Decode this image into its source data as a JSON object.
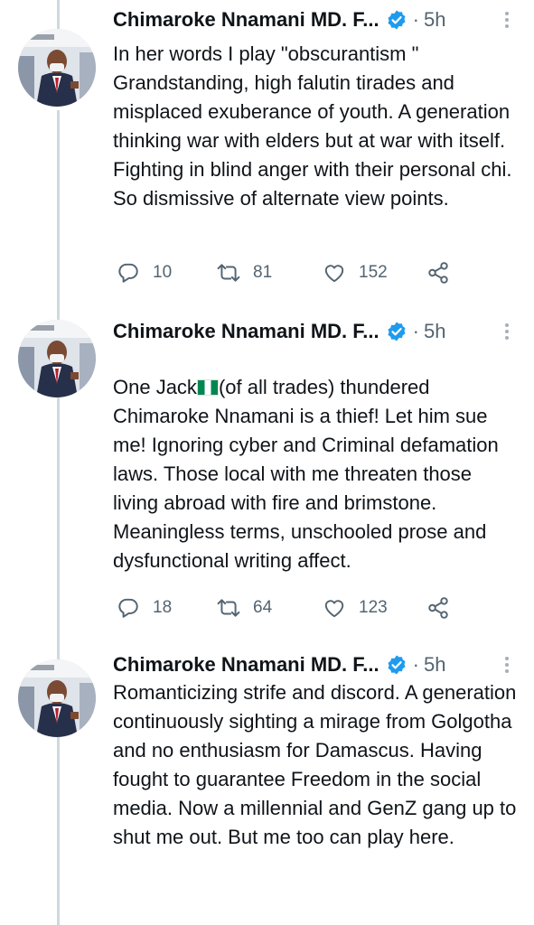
{
  "tweets": [
    {
      "author": "Chimaroke Nnamani MD. F...",
      "separator": "·",
      "time": "5h",
      "text": "In her words I play \"obscurantism \" Grandstanding, high falutin tirades and misplaced exuberance of youth. A generation thinking war with elders but at war with itself. Fighting in blind anger with their personal chi. So dismissive of alternate view points.",
      "replies": "10",
      "retweets": "81",
      "likes": "152"
    },
    {
      "author": "Chimaroke Nnamani MD. F...",
      "separator": "·",
      "time": "5h",
      "text_before_flag": "One Jack",
      "text_after_flag": "(of all trades) thundered Chimaroke Nnamani is a thief! Let him sue me! Ignoring cyber and Criminal defamation laws. Those local with me threaten those living abroad with fire and brimstone. Meaningless terms, unschooled prose and dysfunctional writing affect.",
      "replies": "18",
      "retweets": "64",
      "likes": "123"
    },
    {
      "author": "Chimaroke Nnamani MD. F...",
      "separator": "·",
      "time": "5h",
      "text": "Romanticizing strife and discord. A generation continuously sighting a mirage from Golgotha and no enthusiasm for Damascus. Having fought to guarantee Freedom in the social media. Now a millennial and GenZ gang up to shut me out. But me too can play here."
    }
  ],
  "icons": {
    "reply": "reply-icon",
    "retweet": "retweet-icon",
    "like": "heart-icon",
    "share": "share-icon",
    "verified": "verified-badge-icon",
    "flag": "nigeria-flag-emoji"
  },
  "colors": {
    "verified": "#1d9bf0",
    "secondary_text": "#536471",
    "thread_line": "#cfd9de",
    "flag_green": "#008751"
  }
}
